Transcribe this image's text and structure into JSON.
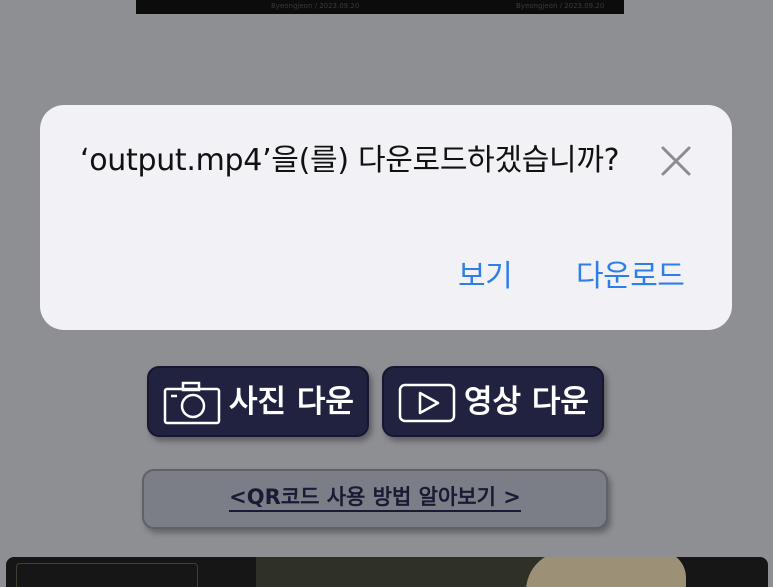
{
  "top_strip": {
    "left_text": "Byeongjeon / 2023.09.20",
    "right_text": "Byeongjeon / 2023.09.20"
  },
  "dialog": {
    "message": "‘output.mp4’을(를) 다운로드하겠습니까?",
    "view_label": "보기",
    "download_label": "다운로드",
    "accent_color": "#2f7ee8"
  },
  "buttons": {
    "photo_label": "사진 다운",
    "photo_icon": "camera-icon",
    "video_label": "영상 다운",
    "video_icon": "play-icon",
    "qr_label": "<QR코드 사용 방법 알아보기 >"
  }
}
